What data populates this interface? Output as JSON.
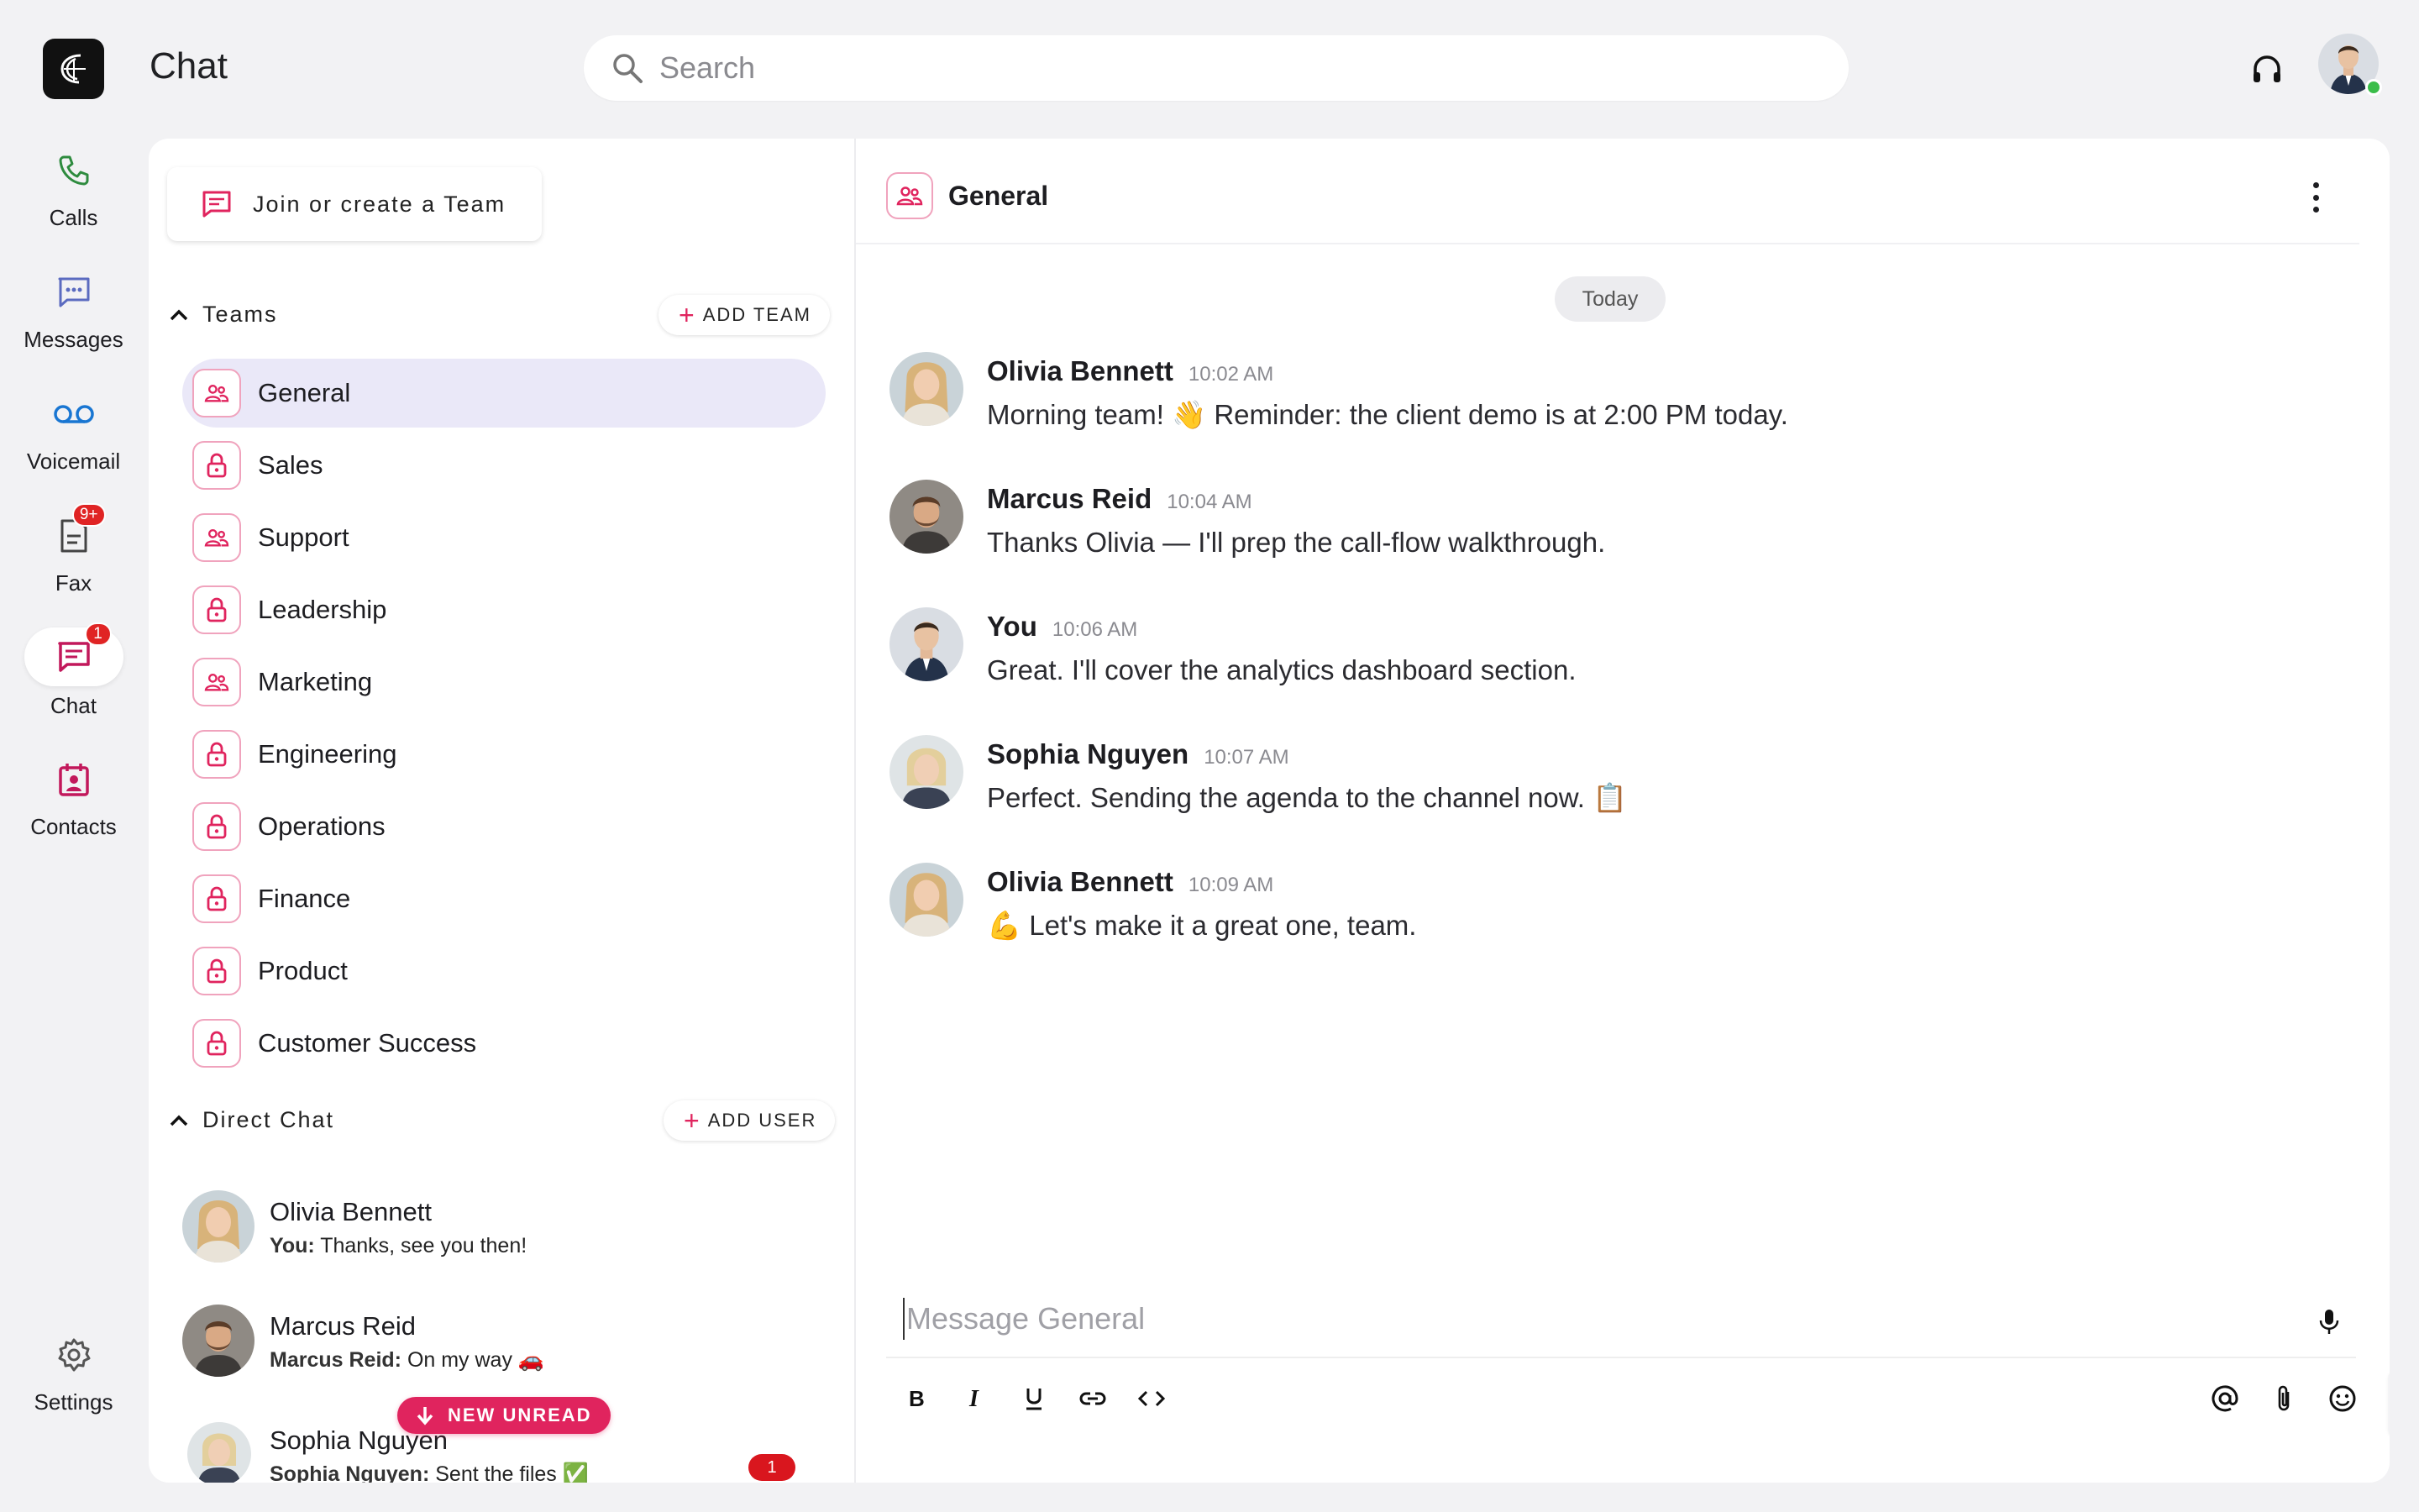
{
  "app": {
    "title": "Chat",
    "search_placeholder": "Search"
  },
  "rail": [
    {
      "label": "Calls",
      "icon": "phone-icon"
    },
    {
      "label": "Messages",
      "icon": "message-icon"
    },
    {
      "label": "Voicemail",
      "icon": "voicemail-icon"
    },
    {
      "label": "Fax",
      "icon": "fax-icon",
      "badge": "9+"
    },
    {
      "label": "Chat",
      "icon": "chat-icon",
      "badge": "1",
      "active": true
    },
    {
      "label": "Contacts",
      "icon": "contacts-icon"
    },
    {
      "label": "Settings",
      "icon": "gear-icon"
    }
  ],
  "sidebar": {
    "join_label": "Join or create a Team",
    "teams_header": "Teams",
    "add_team_label": "ADD TEAM",
    "teams": [
      {
        "name": "General",
        "type": "public",
        "selected": true
      },
      {
        "name": "Sales",
        "type": "private"
      },
      {
        "name": "Support",
        "type": "public"
      },
      {
        "name": "Leadership",
        "type": "private"
      },
      {
        "name": "Marketing",
        "type": "public"
      },
      {
        "name": "Engineering",
        "type": "private"
      },
      {
        "name": "Operations",
        "type": "private"
      },
      {
        "name": "Finance",
        "type": "private"
      },
      {
        "name": "Product",
        "type": "private"
      },
      {
        "name": "Customer Success",
        "type": "private"
      }
    ],
    "direct_header": "Direct Chat",
    "add_user_label": "ADD USER",
    "direct": [
      {
        "name": "Olivia Bennett",
        "sender": "You:",
        "preview": "Thanks, see you then!"
      },
      {
        "name": "Marcus Reid",
        "sender": "Marcus Reid:",
        "preview": "On my way 🚗"
      },
      {
        "name": "Sophia Nguyen",
        "sender": "Sophia Nguyen:",
        "preview": "Sent the files ✅",
        "unread": "1"
      }
    ],
    "new_unread_label": "NEW UNREAD"
  },
  "chat": {
    "channel": "General",
    "date_divider": "Today",
    "messages": [
      {
        "author": "Olivia Bennett",
        "time": "10:02 AM",
        "text": "Morning team! 👋 Reminder: the client demo is at 2:00 PM today."
      },
      {
        "author": "Marcus Reid",
        "time": "10:04 AM",
        "text": "Thanks Olivia — I'll prep the call-flow walkthrough."
      },
      {
        "author": "You",
        "time": "10:06 AM",
        "text": "Great. I'll cover the analytics dashboard section."
      },
      {
        "author": "Sophia Nguyen",
        "time": "10:07 AM",
        "text": "Perfect. Sending the agenda to the channel now. 📋"
      },
      {
        "author": "Olivia Bennett",
        "time": "10:09 AM",
        "text": "💪 Let's make it a great one, team."
      }
    ],
    "composer_placeholder": "Message General"
  },
  "colors": {
    "accent": "#e0245e",
    "selected_team_bg": "#eae8f8",
    "badge": "#e02424",
    "online": "#3bbd4a"
  }
}
